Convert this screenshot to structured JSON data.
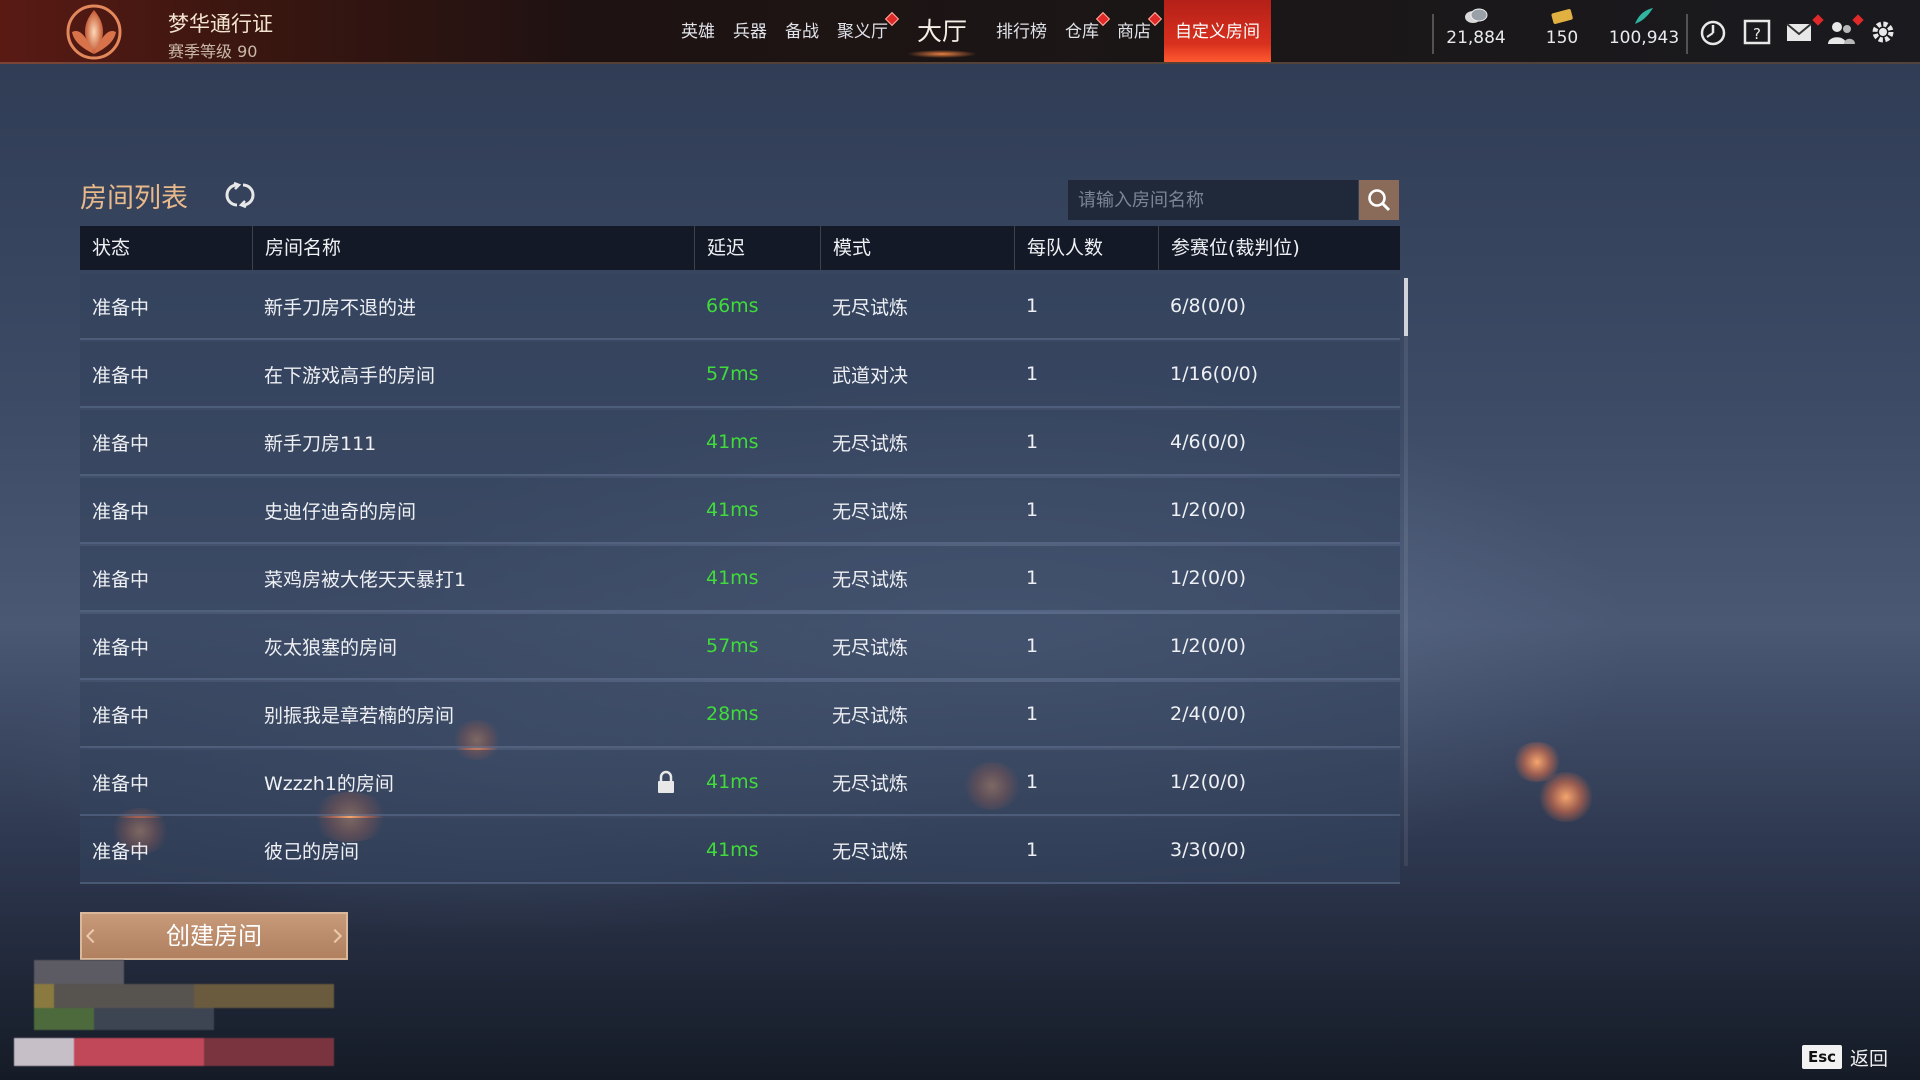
{
  "header": {
    "pass_title": "梦华通行证",
    "season_level": "赛季等级 90",
    "nav": [
      {
        "label": "英雄"
      },
      {
        "label": "兵器"
      },
      {
        "label": "备战"
      },
      {
        "label": "聚义厅"
      },
      {
        "label": "大厅"
      },
      {
        "label": "排行榜"
      },
      {
        "label": "仓库"
      },
      {
        "label": "商店"
      },
      {
        "label": "自定义房间"
      }
    ],
    "currencies": [
      {
        "icon": "coin-icon",
        "value": "21,884"
      },
      {
        "icon": "gold-ticket-icon",
        "value": "150"
      },
      {
        "icon": "feather-icon",
        "value": "100,943"
      }
    ],
    "tool_icons": [
      "timer-icon",
      "help-book-icon",
      "mail-icon",
      "friends-icon",
      "settings-icon"
    ]
  },
  "room_list": {
    "title": "房间列表",
    "search_placeholder": "请输入房间名称",
    "columns": [
      "状态",
      "房间名称",
      "延迟",
      "模式",
      "每队人数",
      "参赛位(裁判位)"
    ],
    "rows": [
      {
        "status": "准备中",
        "name": "新手刀房不退的进",
        "latency": "66ms",
        "mode": "无尽试炼",
        "team_size": "1",
        "slots": "6/8(0/0)",
        "locked": false
      },
      {
        "status": "准备中",
        "name": "在下游戏高手的房间",
        "latency": "57ms",
        "mode": "武道对决",
        "team_size": "1",
        "slots": "1/16(0/0)",
        "locked": false
      },
      {
        "status": "准备中",
        "name": "新手刀房111",
        "latency": "41ms",
        "mode": "无尽试炼",
        "team_size": "1",
        "slots": "4/6(0/0)",
        "locked": false
      },
      {
        "status": "准备中",
        "name": "史迪仔迪奇的房间",
        "latency": "41ms",
        "mode": "无尽试炼",
        "team_size": "1",
        "slots": "1/2(0/0)",
        "locked": false
      },
      {
        "status": "准备中",
        "name": "菜鸡房被大佬天天暴打1",
        "latency": "41ms",
        "mode": "无尽试炼",
        "team_size": "1",
        "slots": "1/2(0/0)",
        "locked": false
      },
      {
        "status": "准备中",
        "name": "灰太狼塞的房间",
        "latency": "57ms",
        "mode": "无尽试炼",
        "team_size": "1",
        "slots": "1/2(0/0)",
        "locked": false
      },
      {
        "status": "准备中",
        "name": "别振我是章若楠的房间",
        "latency": "28ms",
        "mode": "无尽试炼",
        "team_size": "1",
        "slots": "2/4(0/0)",
        "locked": false
      },
      {
        "status": "准备中",
        "name": "Wzzzh1的房间",
        "latency": "41ms",
        "mode": "无尽试炼",
        "team_size": "1",
        "slots": "1/2(0/0)",
        "locked": true
      },
      {
        "status": "准备中",
        "name": "彼己的房间",
        "latency": "41ms",
        "mode": "无尽试炼",
        "team_size": "1",
        "slots": "3/3(0/0)",
        "locked": false
      }
    ]
  },
  "create_button": "创建房间",
  "footer": {
    "esc_key": "Esc",
    "back_label": "返回"
  },
  "colors": {
    "latency_green": "#3fdc3a",
    "title_gold": "#e8b98a",
    "active_tab_red": "#d8301e"
  }
}
